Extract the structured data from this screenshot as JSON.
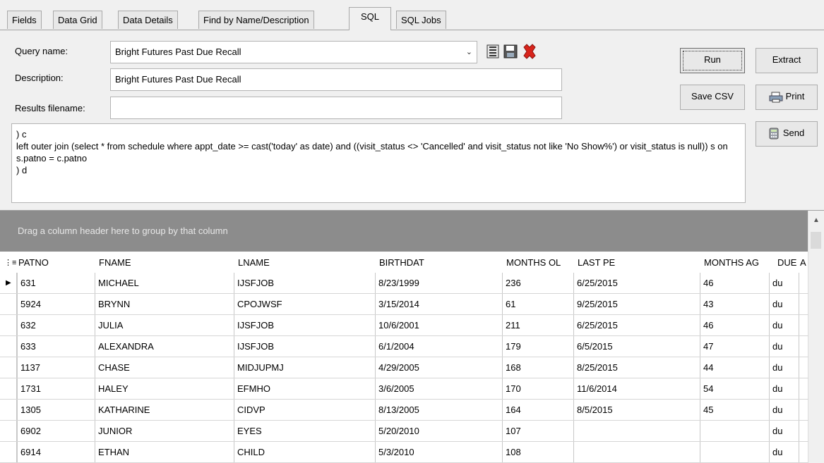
{
  "tabs": [
    {
      "label": "Fields",
      "active": false
    },
    {
      "label": "Data Grid",
      "active": false
    },
    {
      "label": "Data Details",
      "active": false
    },
    {
      "label": "Find by Name/Description",
      "active": false
    },
    {
      "label": "SQL",
      "active": true
    },
    {
      "label": "SQL Jobs",
      "active": false
    }
  ],
  "form": {
    "query_name_label": "Query name:",
    "query_name_value": "Bright Futures Past Due Recall",
    "description_label": "Description:",
    "description_value": "Bright Futures Past Due Recall",
    "results_filename_label": "Results filename:",
    "results_filename_value": ""
  },
  "buttons": {
    "run": "Run",
    "extract": "Extract",
    "save_csv": "Save CSV",
    "print": "Print",
    "send": "Send"
  },
  "icons": {
    "save": "save-icon",
    "save_as": "save-as-icon",
    "delete": "delete-icon",
    "print": "printer-icon",
    "send": "calculator-icon"
  },
  "sql_text": ") c\nleft outer join (select * from schedule where appt_date >= cast('today' as date) and ((visit_status <> 'Cancelled' and visit_status not like 'No Show%') or visit_status is null)) s on s.patno = c.patno\n) d",
  "grid": {
    "group_hint": "Drag a column header here to group by that column",
    "columns": [
      "PATNO",
      "FNAME",
      "LNAME",
      "BIRTHDAT",
      "MONTHS OL",
      "LAST PE",
      "MONTHS AG",
      "DUE",
      "A"
    ],
    "rows": [
      [
        "631",
        "MICHAEL",
        "IJSFJOB",
        "8/23/1999",
        "236",
        "6/25/2015",
        "46",
        "du"
      ],
      [
        "5924",
        "BRYNN",
        "CPOJWSF",
        "3/15/2014",
        "61",
        "9/25/2015",
        "43",
        "du"
      ],
      [
        "632",
        "JULIA",
        "IJSFJOB",
        "10/6/2001",
        "211",
        "6/25/2015",
        "46",
        "du"
      ],
      [
        "633",
        "ALEXANDRA",
        "IJSFJOB",
        "6/1/2004",
        "179",
        "6/5/2015",
        "47",
        "du"
      ],
      [
        "1137",
        "CHASE",
        "MIDJUPMJ",
        "4/29/2005",
        "168",
        "8/25/2015",
        "44",
        "du"
      ],
      [
        "1731",
        "HALEY",
        "EFMHO",
        "3/6/2005",
        "170",
        "11/6/2014",
        "54",
        "du"
      ],
      [
        "1305",
        "KATHARINE",
        "CIDVP",
        "8/13/2005",
        "164",
        "8/5/2015",
        "45",
        "du"
      ],
      [
        "6902",
        "JUNIOR",
        "EYES",
        "5/20/2010",
        "107",
        "",
        "",
        "du"
      ],
      [
        "6914",
        "ETHAN",
        "CHILD",
        "5/3/2010",
        "108",
        "",
        "",
        "du"
      ]
    ]
  }
}
